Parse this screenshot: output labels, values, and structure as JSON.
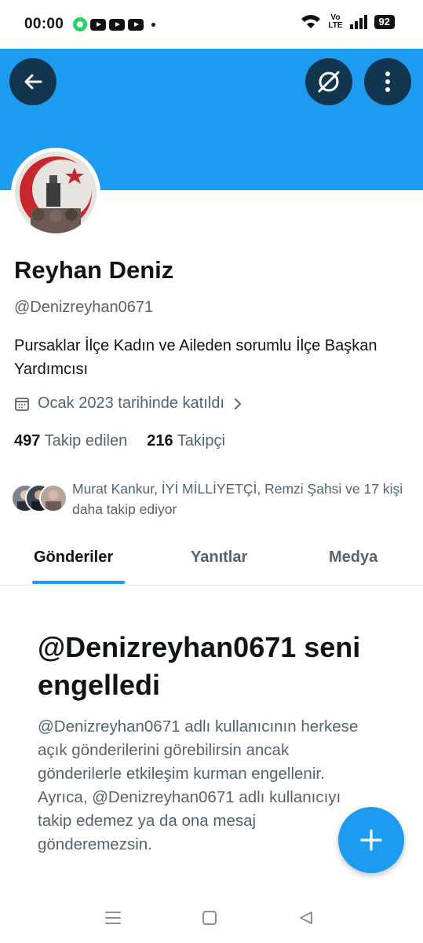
{
  "status_bar": {
    "time": "00:00",
    "volte_top": "Vo",
    "volte_bottom": "LTE",
    "battery": "92",
    "notification_icons": [
      "whatsapp-icon",
      "youtube-icon",
      "youtube-icon",
      "youtube-icon"
    ]
  },
  "header": {
    "banner_color": "#1d9bf0"
  },
  "profile": {
    "name": "Reyhan Deniz",
    "handle": "@Denizreyhan0671",
    "bio": "Pursaklar İlçe Kadın ve Aileden sorumlu İlçe Başkan Yardımcısı",
    "joined": "Ocak 2023 tarihinde katıldı",
    "following_count": "497",
    "following_label": "Takip edilen",
    "followers_count": "216",
    "followers_label": "Takipçi",
    "followed_by_text": "Murat Kankur, İYİ MİLLİYETÇİ, Remzi Şahsi ve 17 kişi daha takip ediyor"
  },
  "tabs": [
    {
      "label": "Gönderiler",
      "active": true
    },
    {
      "label": "Yanıtlar",
      "active": false
    },
    {
      "label": "Medya",
      "active": false
    }
  ],
  "blocked": {
    "title": "@Denizreyhan0671 seni engelledi",
    "description": "@Denizreyhan0671 adlı kullanıcının herkese açık gönderilerini görebilirsin ancak gönderilerle etkileşim kurman engellenir. Ayrıca, @Denizreyhan0671 adlı kullanıcıyı takip edemez ya da ona mesaj gönderemezsin."
  },
  "colors": {
    "accent": "#1d9bf0",
    "text_primary": "#0f1419",
    "text_secondary": "#536471"
  }
}
